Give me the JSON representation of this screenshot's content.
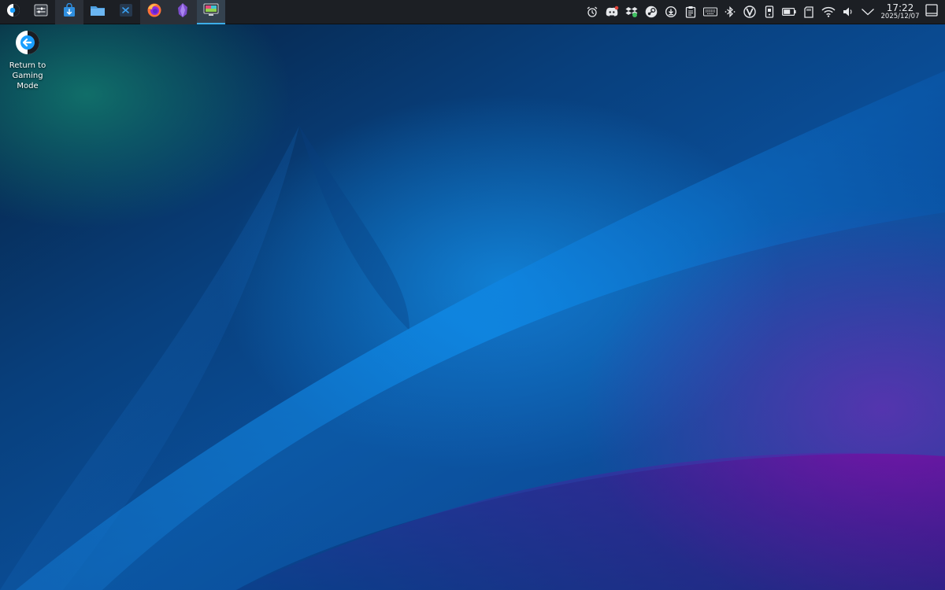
{
  "taskbar": {
    "launcher_icon": "steamos-logo-icon",
    "pinned": [
      {
        "name": "system-settings",
        "icon": "settings-sliders-icon",
        "state": "normal"
      },
      {
        "name": "discover",
        "icon": "shopping-bag-icon",
        "state": "open"
      },
      {
        "name": "dolphin",
        "icon": "folder-icon",
        "state": "normal"
      },
      {
        "name": "vscode",
        "icon": "code-icon",
        "state": "normal"
      },
      {
        "name": "firefox",
        "icon": "firefox-icon",
        "state": "open"
      },
      {
        "name": "obsidian",
        "icon": "obsidian-icon",
        "state": "open"
      },
      {
        "name": "screen-app",
        "icon": "monitor-icon",
        "state": "active"
      }
    ],
    "tray_icons": [
      "alarm-icon",
      "discord-icon",
      "dropbox-icon",
      "steam-icon",
      "update-icon",
      "clipboard-icon",
      "keyboard-icon",
      "bluetooth-icon",
      "vivaldi-icon",
      "device-icon",
      "battery-icon",
      "sd-card-icon",
      "wifi-icon",
      "volume-icon",
      "chevron-down-icon"
    ],
    "clock": {
      "time": "17:22",
      "date": "2025/12/07"
    }
  },
  "desktop": {
    "shortcuts": [
      {
        "label": "Return to Gaming Mode",
        "icon": "return-arrow-icon"
      }
    ]
  },
  "colors": {
    "taskbar_bg": "#1c1f24",
    "accent": "#3daee9",
    "wallpaper_teal": "#127d6e",
    "wallpaper_blue": "#0a4d96",
    "wallpaper_purple": "#960aaa"
  }
}
